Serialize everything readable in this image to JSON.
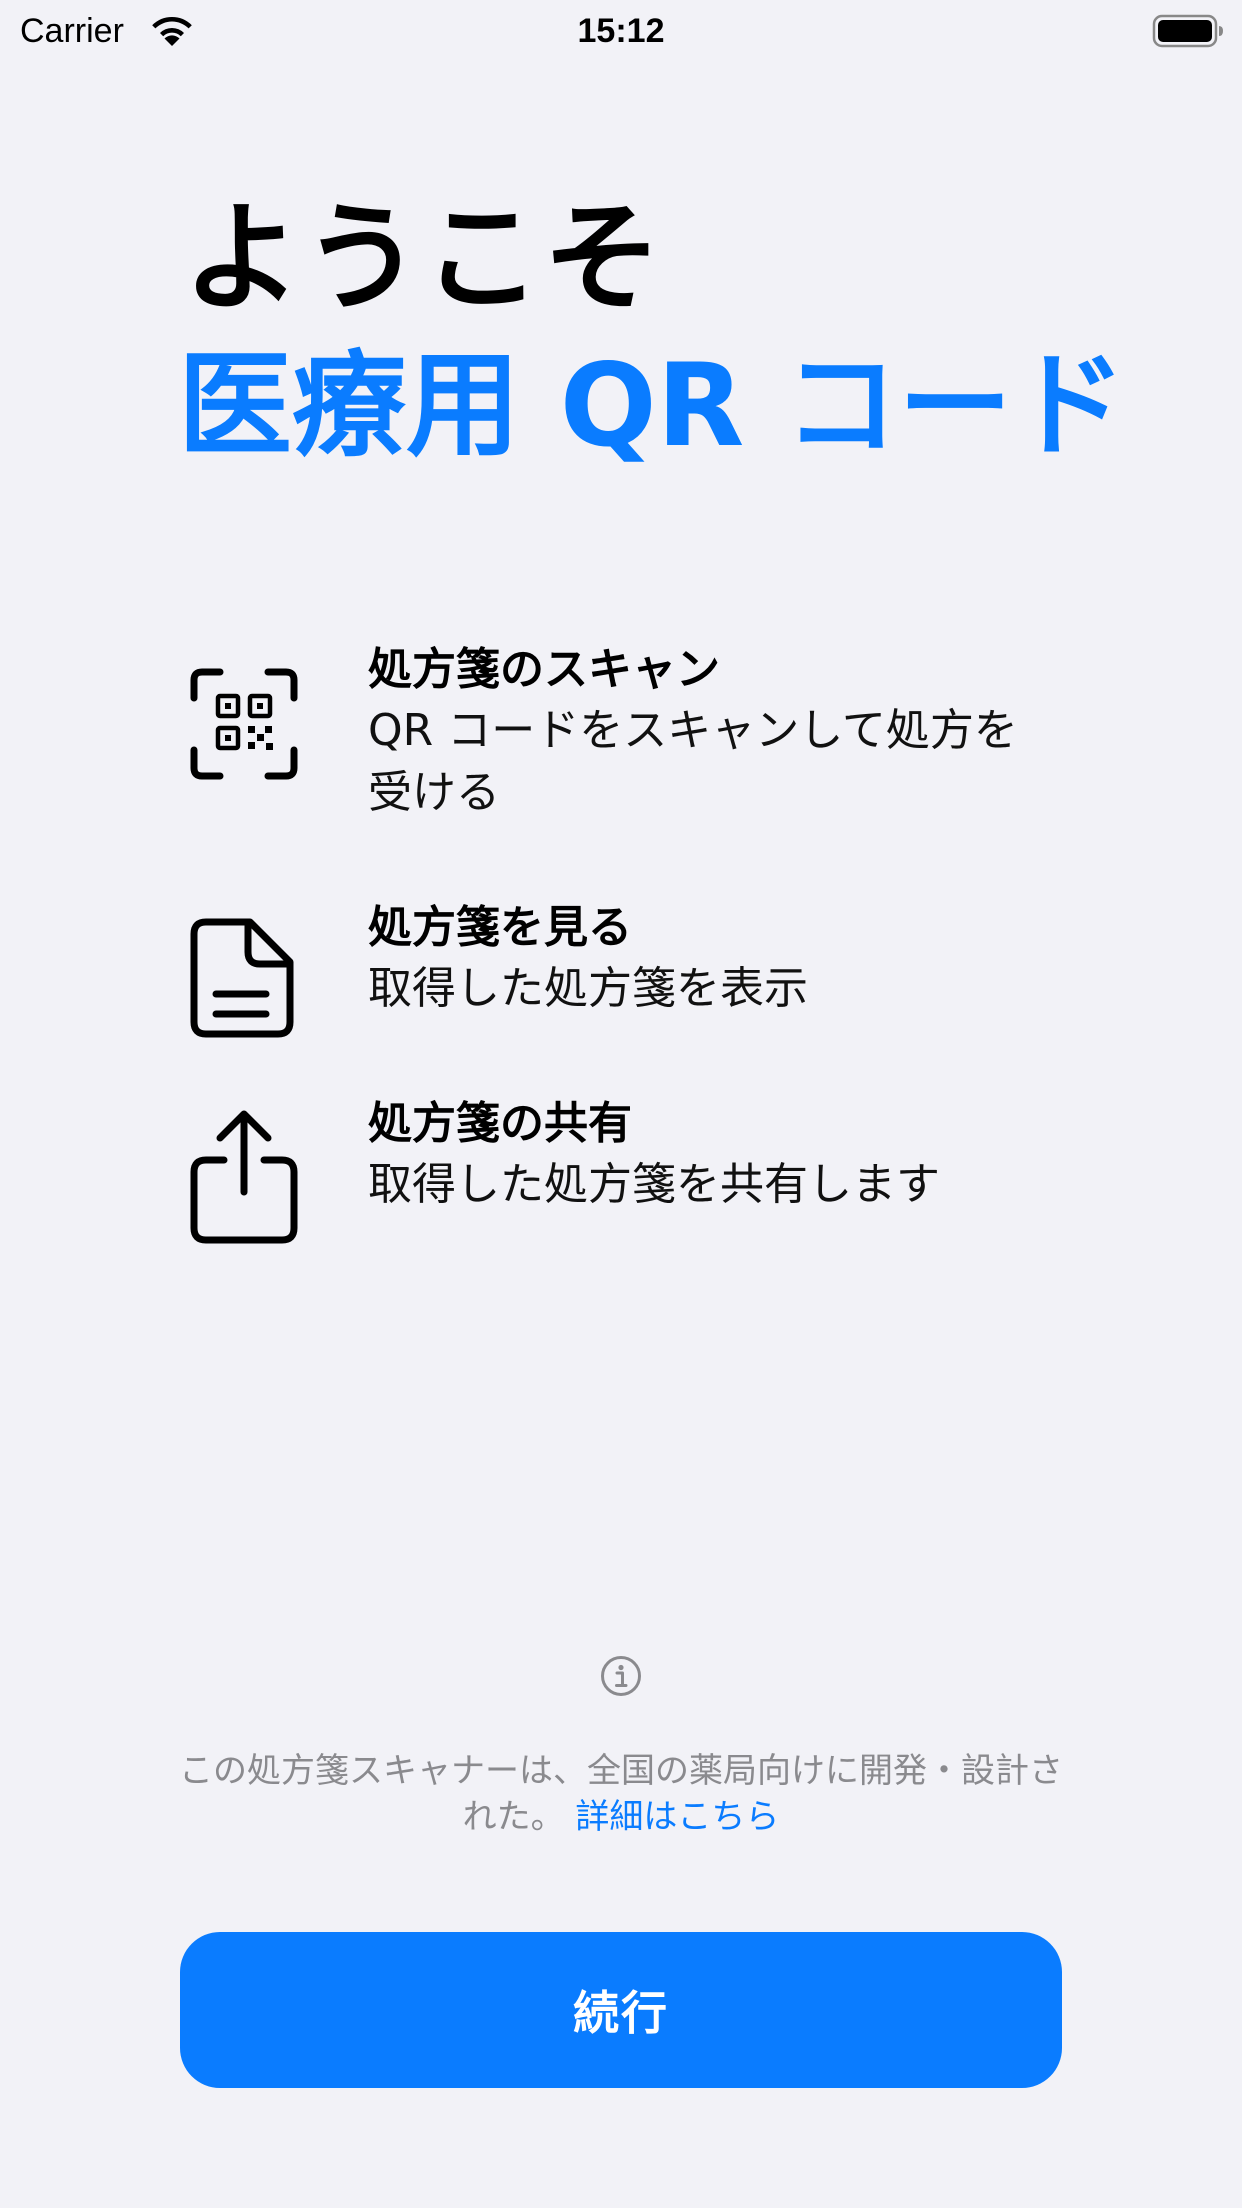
{
  "status_bar": {
    "carrier": "Carrier",
    "time": "15:12",
    "wifi_icon": "wifi-icon",
    "battery_icon": "battery-full-icon"
  },
  "header": {
    "welcome": "ようこそ",
    "app_name": "医療用 QR コード"
  },
  "features": [
    {
      "icon": "qr-code-viewfinder-icon",
      "title": "処方箋のスキャン",
      "description": "QR コードをスキャンして処方を受ける"
    },
    {
      "icon": "document-icon",
      "title": "処方箋を見る",
      "description": "取得した処方箋を表示"
    },
    {
      "icon": "share-icon",
      "title": "処方箋の共有",
      "description": "取得した処方箋を共有します"
    }
  ],
  "info": {
    "icon": "info-circle-icon",
    "text": "この処方箋スキャナーは、全国の薬局向けに開発・設計された。",
    "link": "詳細はこちら"
  },
  "continue_button": {
    "label": "続行"
  },
  "colors": {
    "accent": "#0a7cff",
    "background": "#f2f2f7",
    "secondary_text": "#8a8a8e"
  }
}
